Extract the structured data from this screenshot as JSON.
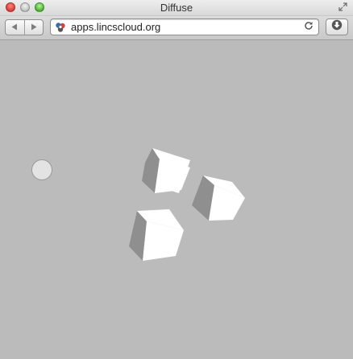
{
  "window": {
    "title": "Diffuse"
  },
  "toolbar": {
    "url": "apps.lincscloud.org"
  },
  "icons": {
    "close": "close-dot",
    "minimize": "minimize-dot",
    "zoom": "zoom-dot",
    "fullscreen": "fullscreen-arrows-icon",
    "back": "back-arrow-icon",
    "forward": "forward-arrow-icon",
    "site": "lincscloud-favicon",
    "reload": "reload-icon",
    "downloads": "downloads-icon"
  },
  "scene": {
    "background_color": "#bbbbbb",
    "cube_top_color": "#ffffff",
    "cube_side_color": "#8e8e8e",
    "ball_color": "#e3e3e3"
  }
}
